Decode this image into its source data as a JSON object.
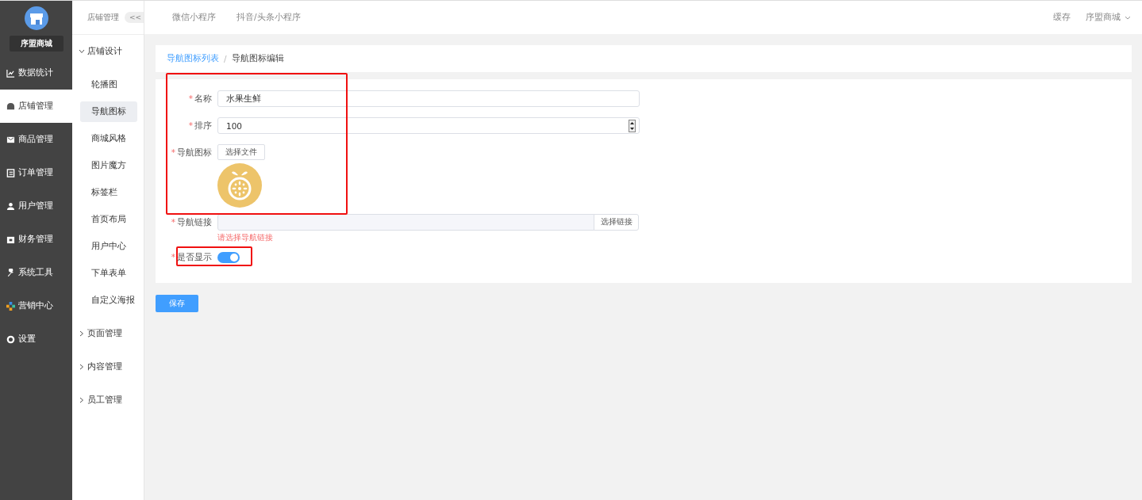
{
  "brand": {
    "name": "序盟商城"
  },
  "main_menu": [
    {
      "label": "数据统计",
      "selected": false
    },
    {
      "label": "店铺管理",
      "selected": true
    },
    {
      "label": "商品管理",
      "selected": false
    },
    {
      "label": "订单管理",
      "selected": false
    },
    {
      "label": "用户管理",
      "selected": false
    },
    {
      "label": "财务管理",
      "selected": false
    },
    {
      "label": "系统工具",
      "selected": false
    },
    {
      "label": "营销中心",
      "selected": false
    },
    {
      "label": "设置",
      "selected": false
    }
  ],
  "sub_menu": {
    "title": "店铺管理",
    "collapse": "<<",
    "groups": [
      {
        "label": "店铺设计",
        "expanded": true,
        "children": [
          {
            "label": "轮播图",
            "selected": false
          },
          {
            "label": "导航图标",
            "selected": true
          },
          {
            "label": "商城风格",
            "selected": false
          },
          {
            "label": "图片魔方",
            "selected": false
          },
          {
            "label": "标签栏",
            "selected": false
          },
          {
            "label": "首页布局",
            "selected": false
          },
          {
            "label": "用户中心",
            "selected": false
          },
          {
            "label": "下单表单",
            "selected": false
          },
          {
            "label": "自定义海报",
            "selected": false
          }
        ]
      },
      {
        "label": "页面管理",
        "expanded": false
      },
      {
        "label": "内容管理",
        "expanded": false
      },
      {
        "label": "员工管理",
        "expanded": false
      }
    ]
  },
  "top_tabs": [
    "微信小程序",
    "抖音/头条小程序"
  ],
  "top_right": {
    "cache": "缓存",
    "store": "序盟商城"
  },
  "breadcrumb": [
    {
      "label": "导航图标列表",
      "link": true
    },
    {
      "label": "导航图标编辑",
      "link": false
    }
  ],
  "separator": "/",
  "form": [
    {
      "kind": "text",
      "required_mark": "*",
      "label": "名称",
      "value": "水果生鲜"
    },
    {
      "kind": "number",
      "required_mark": "*",
      "label": "排序",
      "value": "100"
    },
    {
      "kind": "upload",
      "required_mark": "*",
      "label": "导航图标",
      "button": "选择文件"
    },
    {
      "kind": "link",
      "required_mark": "*",
      "label": "导航链接",
      "button": "选择链接",
      "error": "请选择导航链接"
    },
    {
      "kind": "switch",
      "required_mark": "*",
      "label": "是否显示",
      "on": true
    }
  ],
  "save_button": "保存"
}
